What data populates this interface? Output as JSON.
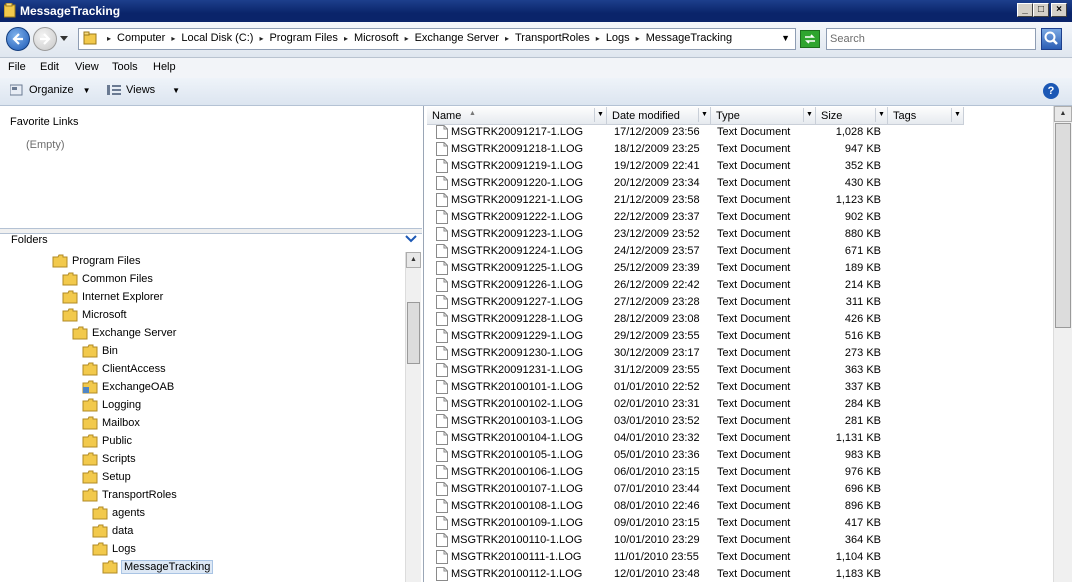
{
  "window": {
    "title": "MessageTracking"
  },
  "window_buttons": {
    "minimize": "_",
    "maximize": "□",
    "close": "×"
  },
  "address": {
    "crumbs": [
      "Computer",
      "Local Disk (C:)",
      "Program Files",
      "Microsoft",
      "Exchange Server",
      "TransportRoles",
      "Logs",
      "MessageTracking"
    ]
  },
  "search": {
    "placeholder": "Search"
  },
  "menu": {
    "file": "File",
    "edit": "Edit",
    "view": "View",
    "tools": "Tools",
    "help": "Help"
  },
  "command": {
    "organize": "Organize",
    "views": "Views"
  },
  "favorites": {
    "title": "Favorite Links",
    "empty": "(Empty)"
  },
  "folders": {
    "title": "Folders",
    "tree": [
      {
        "label": "Program Files",
        "level": 0,
        "icon": "folder-icon"
      },
      {
        "label": "Common Files",
        "level": 1,
        "icon": "folder-icon"
      },
      {
        "label": "Internet Explorer",
        "level": 1,
        "icon": "folder-icon"
      },
      {
        "label": "Microsoft",
        "level": 1,
        "icon": "folder-icon"
      },
      {
        "label": "Exchange Server",
        "level": 2,
        "icon": "folder-icon"
      },
      {
        "label": "Bin",
        "level": 3,
        "icon": "folder-icon"
      },
      {
        "label": "ClientAccess",
        "level": 3,
        "icon": "folder-icon"
      },
      {
        "label": "ExchangeOAB",
        "level": 3,
        "icon": "shared-folder-icon"
      },
      {
        "label": "Logging",
        "level": 3,
        "icon": "folder-icon"
      },
      {
        "label": "Mailbox",
        "level": 3,
        "icon": "folder-icon"
      },
      {
        "label": "Public",
        "level": 3,
        "icon": "folder-icon"
      },
      {
        "label": "Scripts",
        "level": 3,
        "icon": "folder-icon"
      },
      {
        "label": "Setup",
        "level": 3,
        "icon": "folder-icon"
      },
      {
        "label": "TransportRoles",
        "level": 3,
        "icon": "folder-icon"
      },
      {
        "label": "agents",
        "level": 4,
        "icon": "folder-icon"
      },
      {
        "label": "data",
        "level": 4,
        "icon": "folder-icon"
      },
      {
        "label": "Logs",
        "level": 4,
        "icon": "folder-icon"
      },
      {
        "label": "MessageTracking",
        "level": 5,
        "icon": "folder-icon",
        "selected": true
      }
    ]
  },
  "columns": {
    "name": "Name",
    "date": "Date modified",
    "type": "Type",
    "size": "Size",
    "tags": "Tags"
  },
  "files": [
    {
      "name": "MSGTRK20091217-1.LOG",
      "date": "17/12/2009 23:56",
      "type": "Text Document",
      "size": "1,028 KB"
    },
    {
      "name": "MSGTRK20091218-1.LOG",
      "date": "18/12/2009 23:25",
      "type": "Text Document",
      "size": "947 KB"
    },
    {
      "name": "MSGTRK20091219-1.LOG",
      "date": "19/12/2009 22:41",
      "type": "Text Document",
      "size": "352 KB"
    },
    {
      "name": "MSGTRK20091220-1.LOG",
      "date": "20/12/2009 23:34",
      "type": "Text Document",
      "size": "430 KB"
    },
    {
      "name": "MSGTRK20091221-1.LOG",
      "date": "21/12/2009 23:58",
      "type": "Text Document",
      "size": "1,123 KB"
    },
    {
      "name": "MSGTRK20091222-1.LOG",
      "date": "22/12/2009 23:37",
      "type": "Text Document",
      "size": "902 KB"
    },
    {
      "name": "MSGTRK20091223-1.LOG",
      "date": "23/12/2009 23:52",
      "type": "Text Document",
      "size": "880 KB"
    },
    {
      "name": "MSGTRK20091224-1.LOG",
      "date": "24/12/2009 23:57",
      "type": "Text Document",
      "size": "671 KB"
    },
    {
      "name": "MSGTRK20091225-1.LOG",
      "date": "25/12/2009 23:39",
      "type": "Text Document",
      "size": "189 KB"
    },
    {
      "name": "MSGTRK20091226-1.LOG",
      "date": "26/12/2009 22:42",
      "type": "Text Document",
      "size": "214 KB"
    },
    {
      "name": "MSGTRK20091227-1.LOG",
      "date": "27/12/2009 23:28",
      "type": "Text Document",
      "size": "311 KB"
    },
    {
      "name": "MSGTRK20091228-1.LOG",
      "date": "28/12/2009 23:08",
      "type": "Text Document",
      "size": "426 KB"
    },
    {
      "name": "MSGTRK20091229-1.LOG",
      "date": "29/12/2009 23:55",
      "type": "Text Document",
      "size": "516 KB"
    },
    {
      "name": "MSGTRK20091230-1.LOG",
      "date": "30/12/2009 23:17",
      "type": "Text Document",
      "size": "273 KB"
    },
    {
      "name": "MSGTRK20091231-1.LOG",
      "date": "31/12/2009 23:55",
      "type": "Text Document",
      "size": "363 KB"
    },
    {
      "name": "MSGTRK20100101-1.LOG",
      "date": "01/01/2010 22:52",
      "type": "Text Document",
      "size": "337 KB"
    },
    {
      "name": "MSGTRK20100102-1.LOG",
      "date": "02/01/2010 23:31",
      "type": "Text Document",
      "size": "284 KB"
    },
    {
      "name": "MSGTRK20100103-1.LOG",
      "date": "03/01/2010 23:52",
      "type": "Text Document",
      "size": "281 KB"
    },
    {
      "name": "MSGTRK20100104-1.LOG",
      "date": "04/01/2010 23:32",
      "type": "Text Document",
      "size": "1,131 KB"
    },
    {
      "name": "MSGTRK20100105-1.LOG",
      "date": "05/01/2010 23:36",
      "type": "Text Document",
      "size": "983 KB"
    },
    {
      "name": "MSGTRK20100106-1.LOG",
      "date": "06/01/2010 23:15",
      "type": "Text Document",
      "size": "976 KB"
    },
    {
      "name": "MSGTRK20100107-1.LOG",
      "date": "07/01/2010 23:44",
      "type": "Text Document",
      "size": "696 KB"
    },
    {
      "name": "MSGTRK20100108-1.LOG",
      "date": "08/01/2010 22:46",
      "type": "Text Document",
      "size": "896 KB"
    },
    {
      "name": "MSGTRK20100109-1.LOG",
      "date": "09/01/2010 23:15",
      "type": "Text Document",
      "size": "417 KB"
    },
    {
      "name": "MSGTRK20100110-1.LOG",
      "date": "10/01/2010 23:29",
      "type": "Text Document",
      "size": "364 KB"
    },
    {
      "name": "MSGTRK20100111-1.LOG",
      "date": "11/01/2010 23:55",
      "type": "Text Document",
      "size": "1,104 KB"
    },
    {
      "name": "MSGTRK20100112-1.LOG",
      "date": "12/01/2010 23:48",
      "type": "Text Document",
      "size": "1,183 KB"
    }
  ],
  "colors": {
    "titlebar": "#0a246a",
    "selection": "#dde8f5",
    "folder": "#f2c94c"
  }
}
